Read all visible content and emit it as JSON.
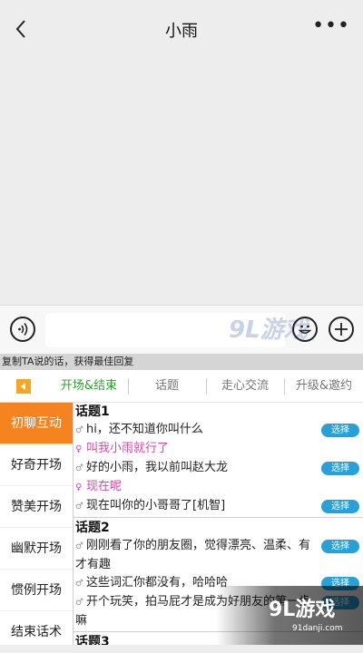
{
  "header": {
    "title": "小雨",
    "back_icon": "back-chevron-icon",
    "more_label": "•••"
  },
  "input_bar": {
    "placeholder": "",
    "watermark": "9L游戏",
    "watermark_sub": "91danji.com"
  },
  "tip": "复制TA说的话，获得最佳回复",
  "tabs": [
    {
      "label": "开场&结束",
      "active": true
    },
    {
      "label": "话题",
      "active": false
    },
    {
      "label": "走心交流",
      "active": false
    },
    {
      "label": "升级&邀约",
      "active": false
    }
  ],
  "sidebar": [
    {
      "label": "初聊互动",
      "active": true
    },
    {
      "label": "好奇开场",
      "active": false
    },
    {
      "label": "赞美开场",
      "active": false
    },
    {
      "label": "幽默开场",
      "active": false
    },
    {
      "label": "惯例开场",
      "active": false
    },
    {
      "label": "结束话术",
      "active": false
    }
  ],
  "topics": [
    {
      "title": "话题1",
      "lines": [
        {
          "gender": "male",
          "symbol": "♂",
          "text": "hi，还不知道你叫什么",
          "select": "选择"
        },
        {
          "gender": "female",
          "symbol": "♀",
          "text": "叫我小雨就行了",
          "select": ""
        },
        {
          "gender": "male",
          "symbol": "♂",
          "text": "好的小雨，我以前叫赵大龙",
          "select": "选择"
        },
        {
          "gender": "female",
          "symbol": "♀",
          "text": "现在呢",
          "select": ""
        },
        {
          "gender": "male",
          "symbol": "♂",
          "text": "现在叫你的小哥哥了[机智]",
          "select": "选择"
        }
      ]
    },
    {
      "title": "话题2",
      "lines": [
        {
          "gender": "male",
          "symbol": "♂",
          "text": "刚刚看了你的朋友圈，觉得漂亮、温柔、有才有趣",
          "select": "选择"
        },
        {
          "gender": "male",
          "symbol": "♂",
          "text": "这些词汇你都没有，哈哈哈",
          "select": "选择"
        },
        {
          "gender": "male",
          "symbol": "♂",
          "text": "开个玩笑，拍马屁才是成为好朋友的第一步嘛",
          "select": "选择"
        }
      ]
    },
    {
      "title": "话题3",
      "lines": []
    }
  ],
  "bottom_watermark": {
    "text": "9L游戏",
    "sub": "91danji.com"
  }
}
